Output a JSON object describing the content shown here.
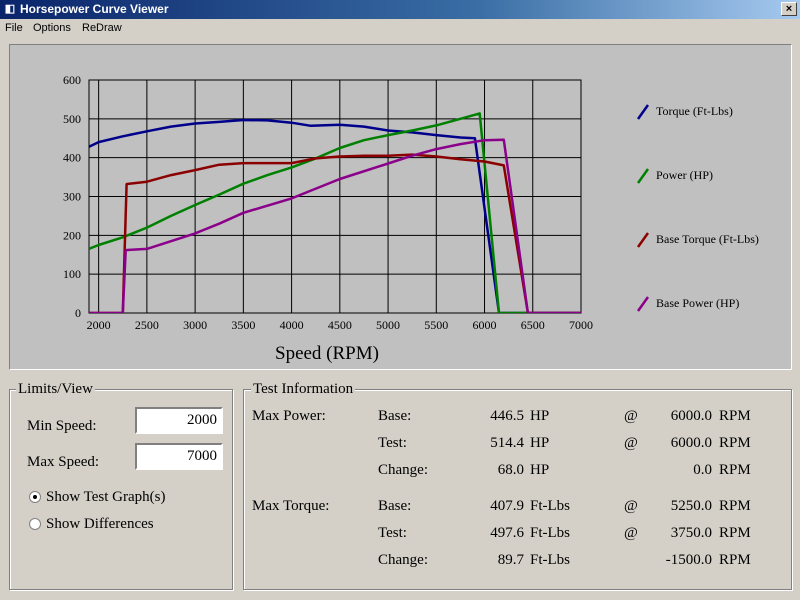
{
  "window": {
    "title": "Horsepower Curve Viewer",
    "close_glyph": "×"
  },
  "menu": [
    "File",
    "Options",
    "ReDraw"
  ],
  "chart_data": {
    "type": "line",
    "xlabel": "Speed (RPM)",
    "ylabel": "",
    "xlim": [
      1900,
      7000
    ],
    "ylim": [
      0,
      600
    ],
    "xticks": [
      2000,
      2500,
      3000,
      3500,
      4000,
      4500,
      5000,
      5500,
      6000,
      6500,
      7000
    ],
    "yticks": [
      0,
      100,
      200,
      300,
      400,
      500,
      600
    ],
    "grid": true,
    "legend_position": "right",
    "series": [
      {
        "name": "Torque (Ft-Lbs)",
        "color": "#00008b",
        "points": [
          [
            1900,
            428
          ],
          [
            2000,
            440
          ],
          [
            2250,
            455
          ],
          [
            2500,
            468
          ],
          [
            2750,
            480
          ],
          [
            3000,
            488
          ],
          [
            3250,
            492
          ],
          [
            3500,
            497
          ],
          [
            3750,
            496
          ],
          [
            4000,
            490
          ],
          [
            4200,
            482
          ],
          [
            4500,
            485
          ],
          [
            4750,
            480
          ],
          [
            5000,
            470
          ],
          [
            5250,
            465
          ],
          [
            5500,
            458
          ],
          [
            5750,
            452
          ],
          [
            5900,
            450
          ],
          [
            6150,
            0
          ],
          [
            7000,
            0
          ]
        ]
      },
      {
        "name": "Power (HP)",
        "color": "#008000",
        "points": [
          [
            1900,
            165
          ],
          [
            2000,
            175
          ],
          [
            2250,
            195
          ],
          [
            2500,
            220
          ],
          [
            2750,
            250
          ],
          [
            3000,
            278
          ],
          [
            3250,
            305
          ],
          [
            3500,
            333
          ],
          [
            3750,
            355
          ],
          [
            4000,
            375
          ],
          [
            4250,
            398
          ],
          [
            4500,
            425
          ],
          [
            4750,
            445
          ],
          [
            5000,
            458
          ],
          [
            5250,
            470
          ],
          [
            5500,
            483
          ],
          [
            5750,
            500
          ],
          [
            5950,
            514
          ],
          [
            6150,
            0
          ],
          [
            7000,
            0
          ]
        ]
      },
      {
        "name": "Base Torque (Ft-Lbs)",
        "color": "#8b0000",
        "points": [
          [
            1900,
            0
          ],
          [
            2250,
            0
          ],
          [
            2290,
            332
          ],
          [
            2500,
            338
          ],
          [
            2750,
            355
          ],
          [
            3000,
            368
          ],
          [
            3250,
            382
          ],
          [
            3500,
            386
          ],
          [
            4000,
            386
          ],
          [
            4250,
            398
          ],
          [
            4500,
            403
          ],
          [
            4750,
            405
          ],
          [
            5000,
            405
          ],
          [
            5250,
            408
          ],
          [
            5500,
            403
          ],
          [
            5750,
            396
          ],
          [
            6000,
            390
          ],
          [
            6200,
            380
          ],
          [
            6450,
            0
          ],
          [
            7000,
            0
          ]
        ]
      },
      {
        "name": "Base Power (HP)",
        "color": "#8b008b",
        "points": [
          [
            1900,
            0
          ],
          [
            2250,
            0
          ],
          [
            2280,
            162
          ],
          [
            2500,
            165
          ],
          [
            2750,
            185
          ],
          [
            3000,
            205
          ],
          [
            3250,
            230
          ],
          [
            3500,
            258
          ],
          [
            4000,
            295
          ],
          [
            4500,
            345
          ],
          [
            5000,
            385
          ],
          [
            5250,
            405
          ],
          [
            5500,
            422
          ],
          [
            5750,
            435
          ],
          [
            6000,
            445
          ],
          [
            6200,
            446
          ],
          [
            6450,
            0
          ],
          [
            7000,
            0
          ]
        ]
      }
    ]
  },
  "limits": {
    "title": "Limits/View",
    "min_label": "Min Speed:",
    "min_value": "2000",
    "max_label": "Max Speed:",
    "max_value": "7000",
    "radio_test": "Show Test Graph(s)",
    "radio_diff": "Show Differences"
  },
  "test_info": {
    "title": "Test Information",
    "max_power_label": "Max Power:",
    "max_torque_label": "Max Torque:",
    "power_rows": [
      {
        "label": "Base:",
        "value": "446.5",
        "unit": "HP",
        "at": "@",
        "rpm": "6000.0",
        "rpm_unit": "RPM"
      },
      {
        "label": "Test:",
        "value": "514.4",
        "unit": "HP",
        "at": "@",
        "rpm": "6000.0",
        "rpm_unit": "RPM"
      },
      {
        "label": "Change:",
        "value": "68.0",
        "unit": "HP",
        "at": "",
        "rpm": "0.0",
        "rpm_unit": "RPM"
      }
    ],
    "torque_rows": [
      {
        "label": "Base:",
        "value": "407.9",
        "unit": "Ft-Lbs",
        "at": "@",
        "rpm": "5250.0",
        "rpm_unit": "RPM"
      },
      {
        "label": "Test:",
        "value": "497.6",
        "unit": "Ft-Lbs",
        "at": "@",
        "rpm": "3750.0",
        "rpm_unit": "RPM"
      },
      {
        "label": "Change:",
        "value": "89.7",
        "unit": "Ft-Lbs",
        "at": "",
        "rpm": "-1500.0",
        "rpm_unit": "RPM"
      }
    ]
  }
}
